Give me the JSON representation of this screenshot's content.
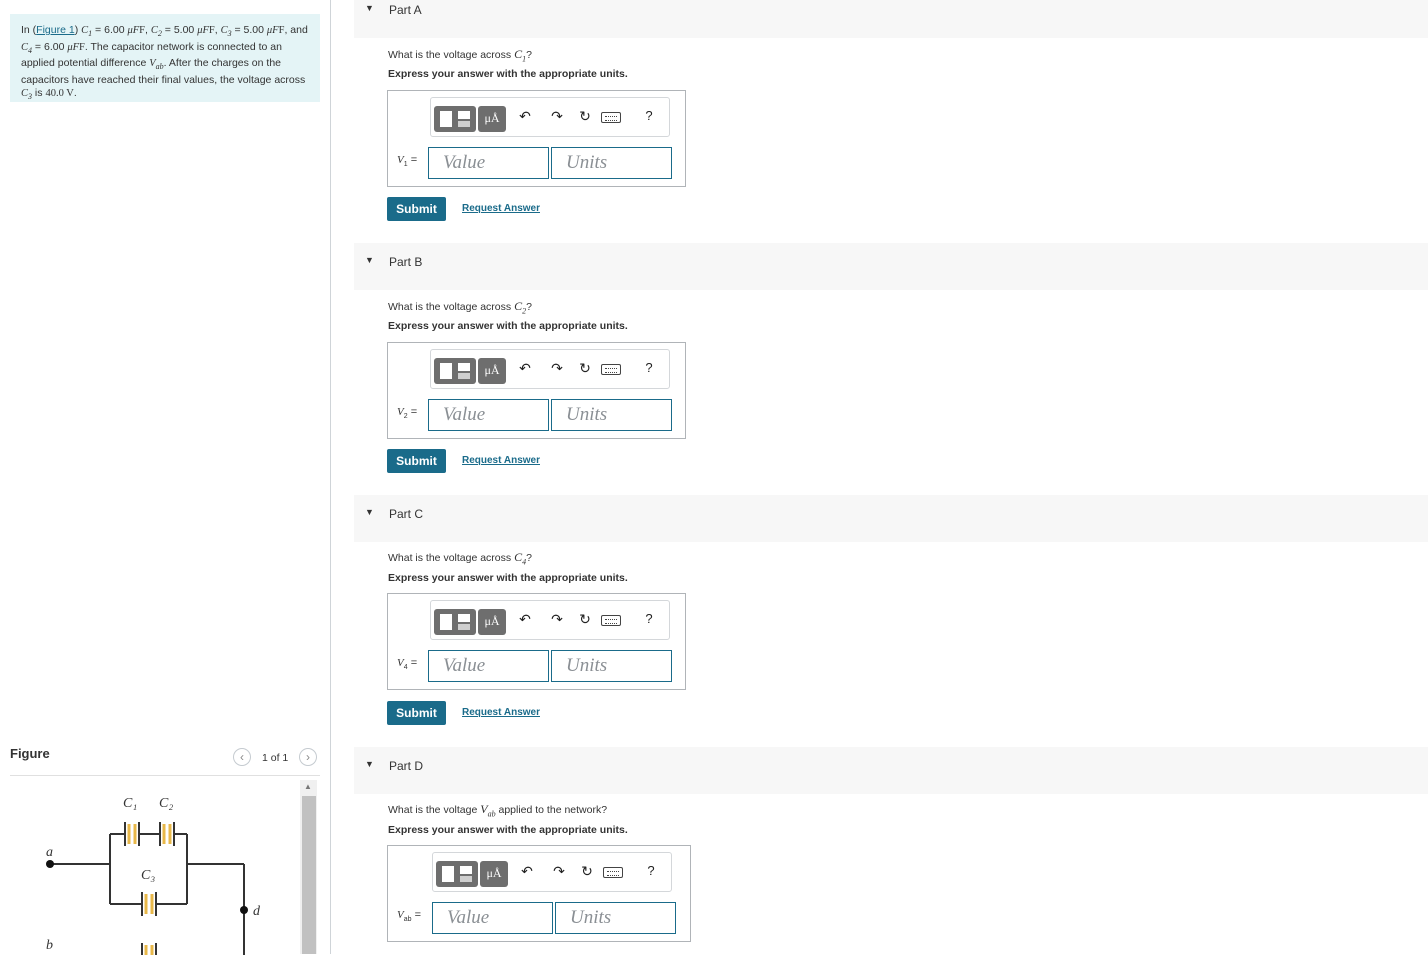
{
  "intro": {
    "prefix": "In (",
    "figure_link": "Figure 1",
    "text_a": ") ",
    "c1": "C",
    "c1_sub": "1",
    "c1_val": " = 6.00 ",
    "unit_uF": "μF",
    "c2_val": " = 5.00 ",
    "c3_val": " = 5.00 ",
    "and": "and ",
    "c4_val": " = 6.00 ",
    "sentence2": ". The capacitor network is connected to an applied potential difference ",
    "vab": "V",
    "vab_sub": "ab",
    "sentence3": ". After the charges on the capacitors have reached their final values, the voltage across ",
    "is": " is ",
    "v40": "40.0 V",
    "period": "."
  },
  "figure_panel": {
    "title": "Figure",
    "counter": "1 of 1",
    "prev_icon": "chevron-left-icon",
    "next_icon": "chevron-right-icon",
    "labels": {
      "a": "a",
      "b": "b",
      "d": "d",
      "C1": "C₁",
      "C2": "C₂",
      "C3": "C₃"
    }
  },
  "parts": [
    {
      "label": "Part A",
      "question": "What is the voltage across ",
      "question_var": "C₁",
      "question_end": "?",
      "instruction": "Express your answer with the appropriate units.",
      "var_label": "V₁ =",
      "value_placeholder": "Value",
      "units_placeholder": "Units",
      "submit": "Submit",
      "request": "Request Answer"
    },
    {
      "label": "Part B",
      "question": "What is the voltage across ",
      "question_var": "C₂",
      "question_end": "?",
      "instruction": "Express your answer with the appropriate units.",
      "var_label": "V₂ =",
      "value_placeholder": "Value",
      "units_placeholder": "Units",
      "submit": "Submit",
      "request": "Request Answer"
    },
    {
      "label": "Part C",
      "question": "What is the voltage across ",
      "question_var": "C₄",
      "question_end": "?",
      "instruction": "Express your answer with the appropriate units.",
      "var_label": "V₄ =",
      "value_placeholder": "Value",
      "units_placeholder": "Units",
      "submit": "Submit",
      "request": "Request Answer"
    },
    {
      "label": "Part D",
      "question": "What is the voltage ",
      "question_var": "Vab",
      "question_end": " applied to the network?",
      "instruction": "Express your answer with the appropriate units.",
      "var_label": "Vab =",
      "value_placeholder": "Value",
      "units_placeholder": "Units"
    }
  ],
  "toolbar": {
    "template_icon": "template-icon",
    "units_label": "μÅ",
    "undo_icon": "undo-icon",
    "redo_icon": "redo-icon",
    "reset_icon": "reset-icon",
    "keyboard_icon": "keyboard-icon",
    "help": "?"
  },
  "colors": {
    "accent": "#1a6b8a",
    "intro_bg": "#e4f4f6",
    "header_bg": "#f7f7f7"
  }
}
